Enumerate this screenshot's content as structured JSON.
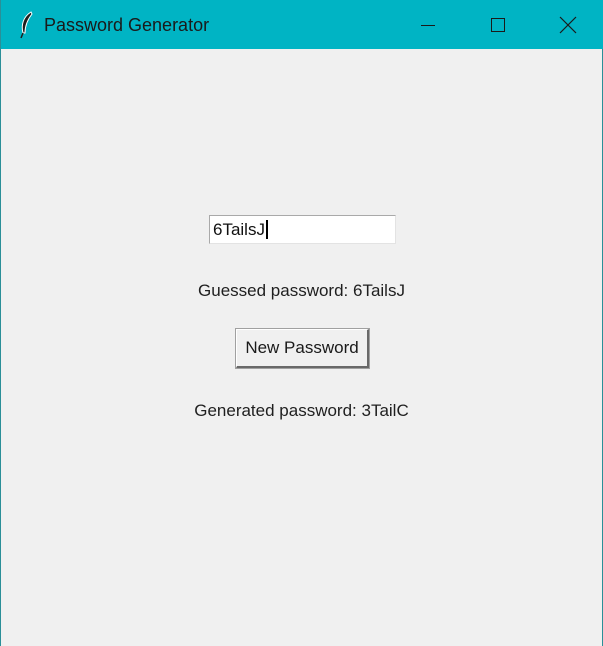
{
  "window": {
    "title": "Password Generator",
    "accent_color": "#00b4c4",
    "icon": "feather-icon",
    "controls": [
      "minimize-icon",
      "maximize-icon",
      "close-icon"
    ]
  },
  "form": {
    "entry_value": "6TailsJ",
    "guessed_label": "Guessed password: 6TailsJ",
    "button_label": "New Password",
    "generated_label": "Generated password: 3TailC"
  }
}
